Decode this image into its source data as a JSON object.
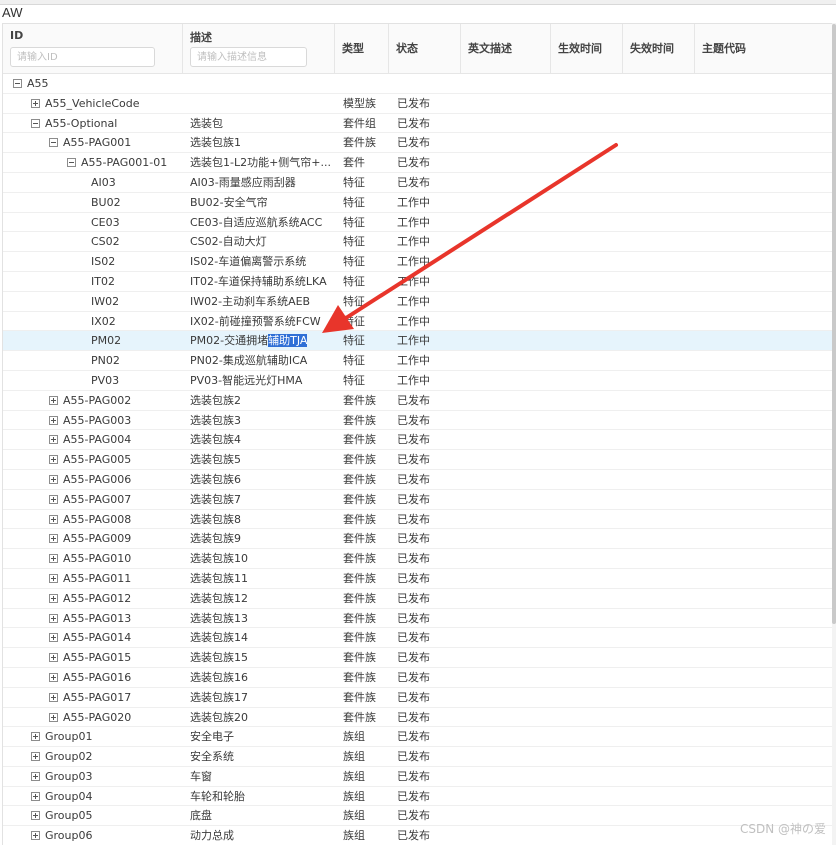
{
  "app_title": "AW",
  "columns": {
    "id": "ID",
    "desc": "描述",
    "type": "类型",
    "status": "状态",
    "en_desc": "英文描述",
    "effective": "生效时间",
    "expire": "失效时间",
    "theme_code": "主题代码"
  },
  "filters": {
    "id_placeholder": "请输入ID",
    "desc_placeholder": "请输入描述信息"
  },
  "rows": [
    {
      "id": "A55",
      "depth": 0,
      "toggle": "minus",
      "desc": "",
      "type": "",
      "status": ""
    },
    {
      "id": "A55_VehicleCode",
      "depth": 1,
      "toggle": "plus",
      "desc": "",
      "type": "模型族",
      "status": "已发布"
    },
    {
      "id": "A55-Optional",
      "depth": 1,
      "toggle": "minus",
      "desc": "选装包",
      "type": "套件组",
      "status": "已发布"
    },
    {
      "id": "A55-PAG001",
      "depth": 2,
      "toggle": "minus",
      "desc": "选装包族1",
      "type": "套件族",
      "status": "已发布"
    },
    {
      "id": "A55-PAG001-01",
      "depth": 3,
      "toggle": "minus",
      "desc": "选装包1-L2功能+侧气帘+...",
      "type": "套件",
      "status": "已发布"
    },
    {
      "id": "AI03",
      "depth": 4,
      "toggle": "",
      "desc": "AI03-雨量感应雨刮器",
      "type": "特征",
      "status": "已发布"
    },
    {
      "id": "BU02",
      "depth": 4,
      "toggle": "",
      "desc": "BU02-安全气帘",
      "type": "特征",
      "status": "工作中"
    },
    {
      "id": "CE03",
      "depth": 4,
      "toggle": "",
      "desc": "CE03-自适应巡航系统ACC",
      "type": "特征",
      "status": "工作中"
    },
    {
      "id": "CS02",
      "depth": 4,
      "toggle": "",
      "desc": "CS02-自动大灯",
      "type": "特征",
      "status": "工作中"
    },
    {
      "id": "IS02",
      "depth": 4,
      "toggle": "",
      "desc": "IS02-车道偏离警示系统",
      "type": "特征",
      "status": "工作中"
    },
    {
      "id": "IT02",
      "depth": 4,
      "toggle": "",
      "desc": "IT02-车道保持辅助系统LKA",
      "type": "特征",
      "status": "工作中"
    },
    {
      "id": "IW02",
      "depth": 4,
      "toggle": "",
      "desc": "IW02-主动刹车系统AEB",
      "type": "特征",
      "status": "工作中"
    },
    {
      "id": "IX02",
      "depth": 4,
      "toggle": "",
      "desc": "IX02-前碰撞预警系统FCW",
      "type": "特征",
      "status": "工作中"
    },
    {
      "id": "PM02",
      "depth": 4,
      "toggle": "",
      "desc": "PM02-交通拥堵",
      "desc_hl": "辅助TJA",
      "type": "特征",
      "status": "工作中",
      "selected": true
    },
    {
      "id": "PN02",
      "depth": 4,
      "toggle": "",
      "desc": "PN02-集成巡航辅助ICA",
      "type": "特征",
      "status": "工作中"
    },
    {
      "id": "PV03",
      "depth": 4,
      "toggle": "",
      "desc": "PV03-智能远光灯HMA",
      "type": "特征",
      "status": "工作中"
    },
    {
      "id": "A55-PAG002",
      "depth": 2,
      "toggle": "plus",
      "desc": "选装包族2",
      "type": "套件族",
      "status": "已发布"
    },
    {
      "id": "A55-PAG003",
      "depth": 2,
      "toggle": "plus",
      "desc": "选装包族3",
      "type": "套件族",
      "status": "已发布"
    },
    {
      "id": "A55-PAG004",
      "depth": 2,
      "toggle": "plus",
      "desc": "选装包族4",
      "type": "套件族",
      "status": "已发布"
    },
    {
      "id": "A55-PAG005",
      "depth": 2,
      "toggle": "plus",
      "desc": "选装包族5",
      "type": "套件族",
      "status": "已发布"
    },
    {
      "id": "A55-PAG006",
      "depth": 2,
      "toggle": "plus",
      "desc": "选装包族6",
      "type": "套件族",
      "status": "已发布"
    },
    {
      "id": "A55-PAG007",
      "depth": 2,
      "toggle": "plus",
      "desc": "选装包族7",
      "type": "套件族",
      "status": "已发布"
    },
    {
      "id": "A55-PAG008",
      "depth": 2,
      "toggle": "plus",
      "desc": "选装包族8",
      "type": "套件族",
      "status": "已发布"
    },
    {
      "id": "A55-PAG009",
      "depth": 2,
      "toggle": "plus",
      "desc": "选装包族9",
      "type": "套件族",
      "status": "已发布"
    },
    {
      "id": "A55-PAG010",
      "depth": 2,
      "toggle": "plus",
      "desc": "选装包族10",
      "type": "套件族",
      "status": "已发布"
    },
    {
      "id": "A55-PAG011",
      "depth": 2,
      "toggle": "plus",
      "desc": "选装包族11",
      "type": "套件族",
      "status": "已发布"
    },
    {
      "id": "A55-PAG012",
      "depth": 2,
      "toggle": "plus",
      "desc": "选装包族12",
      "type": "套件族",
      "status": "已发布"
    },
    {
      "id": "A55-PAG013",
      "depth": 2,
      "toggle": "plus",
      "desc": "选装包族13",
      "type": "套件族",
      "status": "已发布"
    },
    {
      "id": "A55-PAG014",
      "depth": 2,
      "toggle": "plus",
      "desc": "选装包族14",
      "type": "套件族",
      "status": "已发布"
    },
    {
      "id": "A55-PAG015",
      "depth": 2,
      "toggle": "plus",
      "desc": "选装包族15",
      "type": "套件族",
      "status": "已发布"
    },
    {
      "id": "A55-PAG016",
      "depth": 2,
      "toggle": "plus",
      "desc": "选装包族16",
      "type": "套件族",
      "status": "已发布"
    },
    {
      "id": "A55-PAG017",
      "depth": 2,
      "toggle": "plus",
      "desc": "选装包族17",
      "type": "套件族",
      "status": "已发布"
    },
    {
      "id": "A55-PAG020",
      "depth": 2,
      "toggle": "plus",
      "desc": "选装包族20",
      "type": "套件族",
      "status": "已发布"
    },
    {
      "id": "Group01",
      "depth": 1,
      "toggle": "plus",
      "desc": "安全电子",
      "type": "族组",
      "status": "已发布"
    },
    {
      "id": "Group02",
      "depth": 1,
      "toggle": "plus",
      "desc": "安全系统",
      "type": "族组",
      "status": "已发布"
    },
    {
      "id": "Group03",
      "depth": 1,
      "toggle": "plus",
      "desc": "车窗",
      "type": "族组",
      "status": "已发布"
    },
    {
      "id": "Group04",
      "depth": 1,
      "toggle": "plus",
      "desc": "车轮和轮胎",
      "type": "族组",
      "status": "已发布"
    },
    {
      "id": "Group05",
      "depth": 1,
      "toggle": "plus",
      "desc": "底盘",
      "type": "族组",
      "status": "已发布"
    },
    {
      "id": "Group06",
      "depth": 1,
      "toggle": "plus",
      "desc": "动力总成",
      "type": "族组",
      "status": "已发布"
    }
  ],
  "annotation": {
    "arrow_color": "#e8352b"
  },
  "colors": {
    "selected_row": "#e6f4fc",
    "highlight": "#2f6fd6"
  },
  "watermark": "CSDN @神の爱"
}
